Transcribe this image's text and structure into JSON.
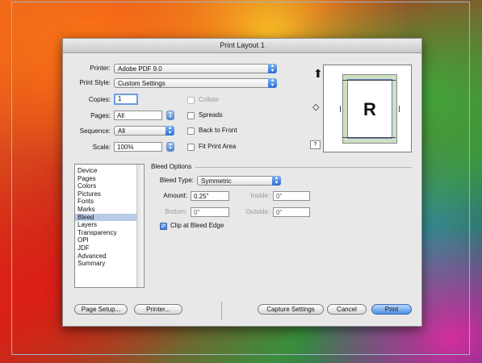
{
  "window": {
    "title": "Print Layout 1"
  },
  "printer": {
    "label": "Printer:",
    "value": "Adobe PDF 9.0"
  },
  "print_style": {
    "label": "Print Style:",
    "value": "Custom Settings"
  },
  "copies": {
    "label": "Copies:",
    "value": "1"
  },
  "pages": {
    "label": "Pages:",
    "value": "All"
  },
  "sequence": {
    "label": "Sequence:",
    "value": "All"
  },
  "scale": {
    "label": "Scale:",
    "value": "100%"
  },
  "checkboxes": {
    "collate": {
      "label": "Collate",
      "checked": false,
      "enabled": false
    },
    "spreads": {
      "label": "Spreads",
      "checked": false,
      "enabled": true
    },
    "back_to_front": {
      "label": "Back to Front",
      "checked": false,
      "enabled": true
    },
    "fit_print_area": {
      "label": "Fit Print Area",
      "checked": false,
      "enabled": true
    }
  },
  "preview": {
    "letter": "R",
    "help_label": "?"
  },
  "sidebar": {
    "items": [
      "Device",
      "Pages",
      "Colors",
      "Pictures",
      "Fonts",
      "Marks",
      "Bleed",
      "Layers",
      "Transparency",
      "OPI",
      "JDF",
      "Advanced",
      "Summary"
    ],
    "selected": "Bleed"
  },
  "bleed": {
    "section_title": "Bleed Options",
    "type_label": "Bleed Type:",
    "type_value": "Symmetric",
    "amount_label": "Amount:",
    "amount_value": "0.25\"",
    "inside_label": "Inside:",
    "inside_value": "0\"",
    "bottom_label": "Bottom:",
    "bottom_value": "0\"",
    "outside_label": "Outside:",
    "outside_value": "0\"",
    "clip_label": "Clip at Bleed Edge",
    "clip_checked": true
  },
  "buttons": {
    "page_setup": "Page Setup...",
    "printer": "Printer...",
    "capture_settings": "Capture Settings",
    "cancel": "Cancel",
    "print": "Print"
  }
}
